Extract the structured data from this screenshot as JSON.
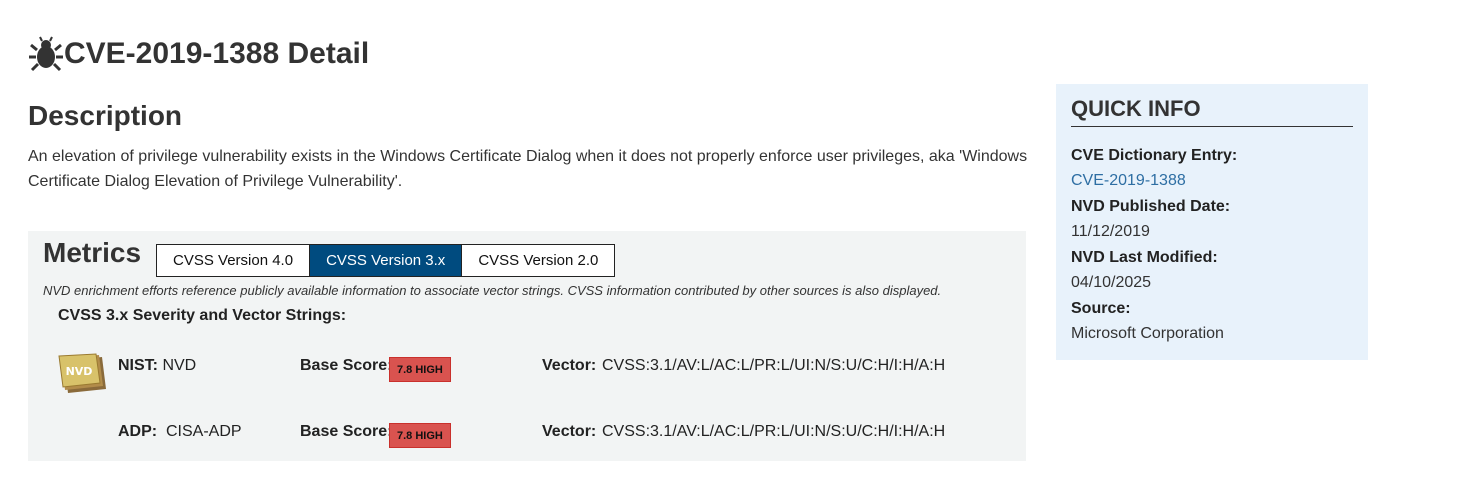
{
  "page": {
    "title": "CVE-2019-1388 Detail"
  },
  "description": {
    "heading": "Description",
    "text": "An elevation of privilege vulnerability exists in the Windows Certificate Dialog when it does not properly enforce user privileges, aka 'Windows Certificate Dialog Elevation of Privilege Vulnerability'."
  },
  "metrics": {
    "heading": "Metrics",
    "tabs": [
      {
        "label": "CVSS Version 4.0",
        "active": false
      },
      {
        "label": "CVSS Version 3.x",
        "active": true
      },
      {
        "label": "CVSS Version 2.0",
        "active": false
      }
    ],
    "note": "NVD enrichment efforts reference publicly available information to associate vector strings. CVSS information contributed by other sources is also displayed.",
    "severity_heading": "CVSS 3.x Severity and Vector Strings:",
    "rows": [
      {
        "source_label": "NIST:",
        "source_value": "NVD",
        "score_label": "Base Score:",
        "score_badge": "7.8 HIGH",
        "vector_label": "Vector:",
        "vector_value": "CVSS:3.1/AV:L/AC:L/PR:L/UI:N/S:U/C:H/I:H/A:H",
        "logo": "NVD"
      },
      {
        "source_label": "ADP:",
        "source_value": "CISA-ADP",
        "score_label": "Base Score:",
        "score_badge": "7.8 HIGH",
        "vector_label": "Vector:",
        "vector_value": "CVSS:3.1/AV:L/AC:L/PR:L/UI:N/S:U/C:H/I:H/A:H"
      }
    ]
  },
  "quick_info": {
    "title": "QUICK INFO",
    "cve_label": "CVE Dictionary Entry:",
    "cve_value": "CVE-2019-1388",
    "published_label": "NVD Published Date:",
    "published_value": "11/12/2019",
    "modified_label": "NVD Last Modified:",
    "modified_value": "04/10/2025",
    "source_label": "Source:",
    "source_value": "Microsoft Corporation"
  },
  "colors": {
    "tab_active": "#004b7f",
    "badge_high": "#d9534f",
    "quick_info_bg": "#e8f2fb",
    "metrics_bg": "#f2f4f4",
    "link": "#2d6ea3"
  }
}
